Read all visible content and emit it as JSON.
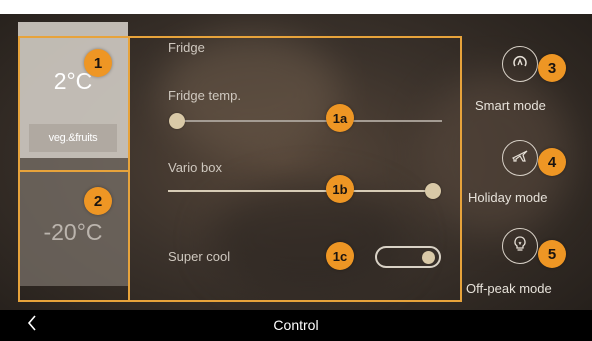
{
  "fridge": {
    "temperature": "2°C",
    "drawer_button": "veg.&fruits",
    "section_label": "Fridge",
    "temp_label": "Fridge temp.",
    "temp_slider_level": 0.0,
    "vario_label": "Vario box",
    "vario_slider_level": 1.0,
    "super_cool_label": "Super cool",
    "super_cool_on": true
  },
  "freezer": {
    "temperature": "-20°C"
  },
  "modes": [
    {
      "label": "Smart mode",
      "icon": "smart-mode-icon"
    },
    {
      "label": "Holiday mode",
      "icon": "airplane-icon"
    },
    {
      "label": "Off-peak mode",
      "icon": "lightbulb-icon"
    }
  ],
  "badges": {
    "fridge_panel": "1",
    "freezer_panel": "2",
    "smart_mode": "3",
    "holiday_mode": "4",
    "off_peak_mode": "5",
    "fridge_temp": "1a",
    "vario_box": "1b",
    "super_cool": "1c"
  },
  "bottom_bar": {
    "title": "Control"
  },
  "colors": {
    "accent_orange": "#ee9624",
    "frame_orange": "#e7a33b",
    "slider_thumb": "#d9c9a7"
  }
}
